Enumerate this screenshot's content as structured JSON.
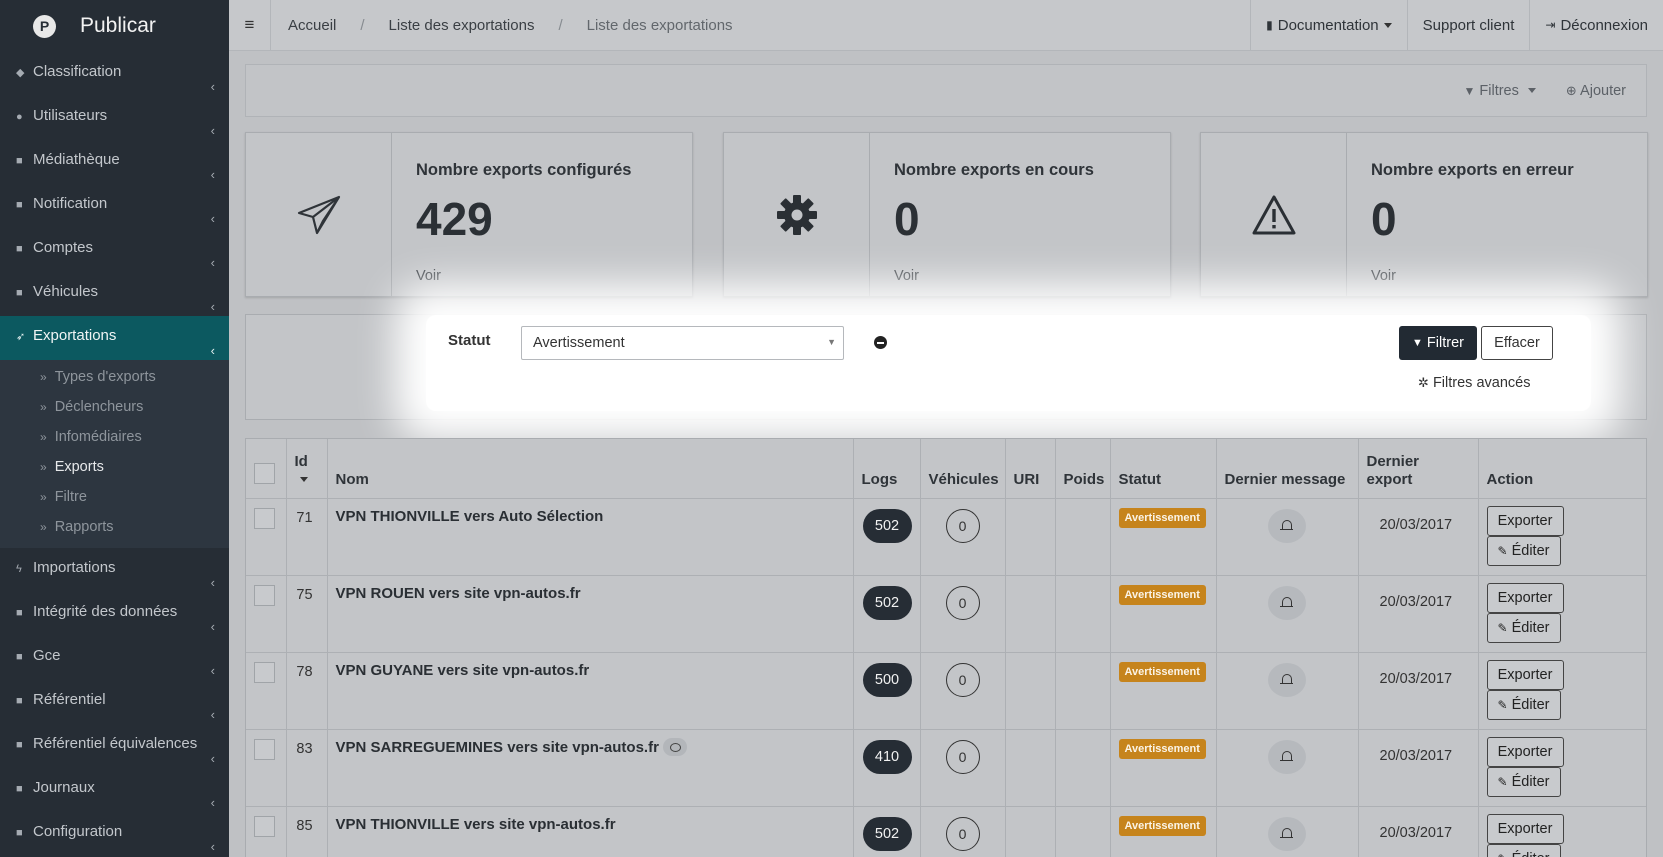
{
  "app": {
    "title": "Publicar",
    "logo_letter": "P"
  },
  "sidebar": {
    "items": [
      {
        "label": "Classification",
        "icon": "tags-icon"
      },
      {
        "label": "Utilisateurs",
        "icon": "users-icon"
      },
      {
        "label": "Médiathèque",
        "icon": "folder-icon"
      },
      {
        "label": "Notification",
        "icon": "folder-icon"
      },
      {
        "label": "Comptes",
        "icon": "folder-icon"
      },
      {
        "label": "Véhicules",
        "icon": "folder-icon"
      },
      {
        "label": "Exportations",
        "icon": "paper-plane-icon",
        "active": true
      },
      {
        "label": "Importations",
        "icon": "bolt-icon"
      },
      {
        "label": "Intégrité des données",
        "icon": "folder-icon"
      },
      {
        "label": "Gce",
        "icon": "folder-icon"
      },
      {
        "label": "Référentiel",
        "icon": "folder-icon"
      },
      {
        "label": "Référentiel équivalences",
        "icon": "folder-icon"
      },
      {
        "label": "Journaux",
        "icon": "folder-icon"
      },
      {
        "label": "Configuration",
        "icon": "folder-icon"
      }
    ],
    "subitems": [
      {
        "label": "Types d'exports"
      },
      {
        "label": "Déclencheurs"
      },
      {
        "label": "Infomédiaires"
      },
      {
        "label": "Exports",
        "active": true
      },
      {
        "label": "Filtre"
      },
      {
        "label": "Rapports"
      }
    ]
  },
  "topbar": {
    "breadcrumbs": [
      "Accueil",
      "Liste des exportations",
      "Liste des exportations"
    ],
    "documentation": "Documentation",
    "support": "Support client",
    "logout": "Déconnexion"
  },
  "toolbar": {
    "filters": "Filtres",
    "add": "Ajouter"
  },
  "cards": [
    {
      "title": "Nombre exports configurés",
      "value": "429",
      "link": "Voir",
      "icon": "paper-plane-icon"
    },
    {
      "title": "Nombre exports en cours",
      "value": "0",
      "link": "Voir",
      "icon": "gear-icon"
    },
    {
      "title": "Nombre exports en erreur",
      "value": "0",
      "link": "Voir",
      "icon": "warning-icon"
    }
  ],
  "filter": {
    "label": "Statut",
    "selected": "Avertissement",
    "filter_button": "Filtrer",
    "clear_button": "Effacer",
    "advanced": "Filtres avancés"
  },
  "table": {
    "headers": [
      "Id",
      "Nom",
      "Logs",
      "Véhicules",
      "URI",
      "Poids",
      "Statut",
      "Dernier message",
      "Dernier export",
      "Action"
    ],
    "rows": [
      {
        "id": "71",
        "name": "VPN THIONVILLE vers Auto Sélection",
        "logs": "502",
        "vehicles": "0",
        "status": "Avertissement",
        "last_export": "20/03/2017",
        "comment": false
      },
      {
        "id": "75",
        "name": "VPN ROUEN vers site vpn-autos.fr",
        "logs": "502",
        "vehicles": "0",
        "status": "Avertissement",
        "last_export": "20/03/2017",
        "comment": false
      },
      {
        "id": "78",
        "name": "VPN GUYANE vers site vpn-autos.fr",
        "logs": "500",
        "vehicles": "0",
        "status": "Avertissement",
        "last_export": "20/03/2017",
        "comment": false
      },
      {
        "id": "83",
        "name": "VPN SARREGUEMINES vers site vpn-autos.fr",
        "logs": "410",
        "vehicles": "0",
        "status": "Avertissement",
        "last_export": "20/03/2017",
        "comment": true
      },
      {
        "id": "85",
        "name": "VPN THIONVILLE vers site vpn-autos.fr",
        "logs": "502",
        "vehicles": "0",
        "status": "Avertissement",
        "last_export": "20/03/2017",
        "comment": false
      }
    ],
    "export_button": "Exporter",
    "edit_button": "Éditer"
  },
  "colors": {
    "sidebar": "#262d35",
    "active": "#0c5960",
    "warning_badge": "#c6841c"
  }
}
